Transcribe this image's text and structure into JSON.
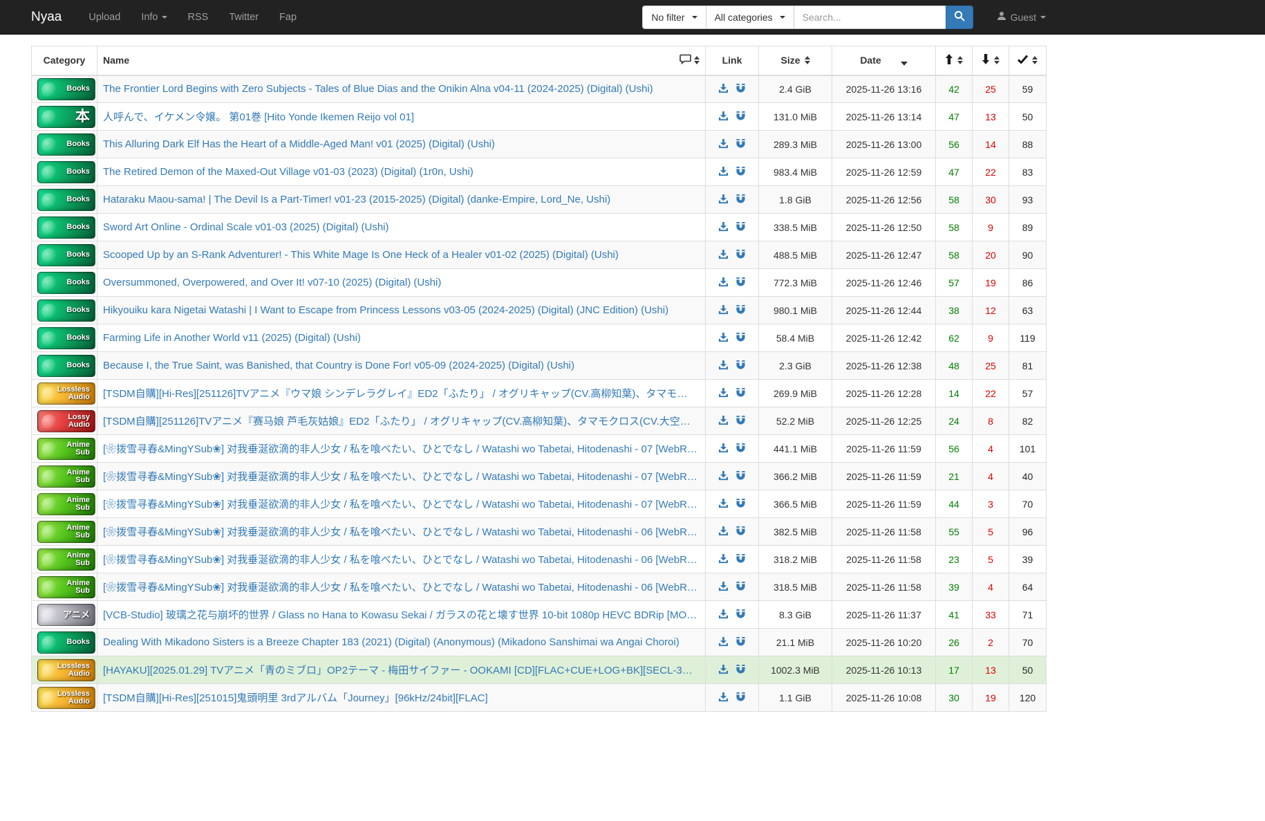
{
  "navbar": {
    "brand": "Nyaa",
    "links": [
      {
        "label": "Upload",
        "caret": false
      },
      {
        "label": "Info",
        "caret": true
      },
      {
        "label": "RSS",
        "caret": false
      },
      {
        "label": "Twitter",
        "caret": false
      },
      {
        "label": "Fap",
        "caret": false
      }
    ],
    "filter_dropdown": "No filter",
    "category_dropdown": "All categories",
    "search_placeholder": "Search...",
    "user_label": "Guest"
  },
  "colors": {
    "navbar_bg": "#222222",
    "accent_blue": "#337ab7",
    "seeders_green": "#008000",
    "leechers_red": "#e00000",
    "success_row_bg": "#dff0d8",
    "striped_row_bg": "#f9f9f9"
  },
  "table": {
    "headers": {
      "category": "Category",
      "name": "Name",
      "link": "Link",
      "size": "Size",
      "date": "Date",
      "seeders_icon": "up-arrow",
      "leechers_icon": "down-arrow",
      "completed_icon": "check"
    }
  },
  "badges": {
    "books-en": {
      "lines": [
        "Books"
      ]
    },
    "books-jp": {
      "lines": [
        "本"
      ]
    },
    "lossless": {
      "lines": [
        "Lossless",
        "Audio"
      ]
    },
    "lossy": {
      "lines": [
        "Lossy",
        "Audio"
      ]
    },
    "anime-sub": {
      "lines": [
        "Anime",
        "Sub"
      ]
    },
    "anime-raw": {
      "lines": [
        "アニメ"
      ]
    }
  },
  "rows": [
    {
      "badge": "books-en",
      "name": "The Frontier Lord Begins with Zero Subjects - Tales of Blue Dias and the Onikin Alna v04-11 (2024-2025) (Digital) (Ushi)",
      "size": "2.4 GiB",
      "date": "2025-11-26 13:16",
      "seeders": "42",
      "leechers": "25",
      "completed": "59",
      "highlight": false
    },
    {
      "badge": "books-jp",
      "name": "人呼んで、イケメン令嬢。 第01巻 [Hito Yonde Ikemen Reijo vol 01]",
      "size": "131.0 MiB",
      "date": "2025-11-26 13:14",
      "seeders": "47",
      "leechers": "13",
      "completed": "50",
      "highlight": false
    },
    {
      "badge": "books-en",
      "name": "This Alluring Dark Elf Has the Heart of a Middle-Aged Man! v01 (2025) (Digital) (Ushi)",
      "size": "289.3 MiB",
      "date": "2025-11-26 13:00",
      "seeders": "56",
      "leechers": "14",
      "completed": "88",
      "highlight": false
    },
    {
      "badge": "books-en",
      "name": "The Retired Demon of the Maxed-Out Village v01-03 (2023) (Digital) (1r0n, Ushi)",
      "size": "983.4 MiB",
      "date": "2025-11-26 12:59",
      "seeders": "47",
      "leechers": "22",
      "completed": "83",
      "highlight": false
    },
    {
      "badge": "books-en",
      "name": "Hataraku Maou-sama! | The Devil Is a Part-Timer! v01-23 (2015-2025) (Digital) (danke-Empire, Lord_Ne, Ushi)",
      "size": "1.8 GiB",
      "date": "2025-11-26 12:56",
      "seeders": "58",
      "leechers": "30",
      "completed": "93",
      "highlight": false
    },
    {
      "badge": "books-en",
      "name": "Sword Art Online - Ordinal Scale v01-03 (2025) (Digital) (Ushi)",
      "size": "338.5 MiB",
      "date": "2025-11-26 12:50",
      "seeders": "58",
      "leechers": "9",
      "completed": "89",
      "highlight": false
    },
    {
      "badge": "books-en",
      "name": "Scooped Up by an S-Rank Adventurer! - This White Mage Is One Heck of a Healer v01-02 (2025) (Digital) (Ushi)",
      "size": "488.5 MiB",
      "date": "2025-11-26 12:47",
      "seeders": "58",
      "leechers": "20",
      "completed": "90",
      "highlight": false
    },
    {
      "badge": "books-en",
      "name": "Oversummoned, Overpowered, and Over It! v07-10 (2025) (Digital) (Ushi)",
      "size": "772.3 MiB",
      "date": "2025-11-26 12:46",
      "seeders": "57",
      "leechers": "19",
      "completed": "86",
      "highlight": false
    },
    {
      "badge": "books-en",
      "name": "Hikyouiku kara Nigetai Watashi | I Want to Escape from Princess Lessons v03-05 (2024-2025) (Digital) (JNC Edition) (Ushi)",
      "size": "980.1 MiB",
      "date": "2025-11-26 12:44",
      "seeders": "38",
      "leechers": "12",
      "completed": "63",
      "highlight": false
    },
    {
      "badge": "books-en",
      "name": "Farming Life in Another World v11 (2025) (Digital) (Ushi)",
      "size": "58.4 MiB",
      "date": "2025-11-26 12:42",
      "seeders": "62",
      "leechers": "9",
      "completed": "119",
      "highlight": false
    },
    {
      "badge": "books-en",
      "name": "Because I, the True Saint, was Banished, that Country is Done For! v05-09 (2024-2025) (Digital) (Ushi)",
      "size": "2.3 GiB",
      "date": "2025-11-26 12:38",
      "seeders": "48",
      "leechers": "25",
      "completed": "81",
      "highlight": false
    },
    {
      "badge": "lossless",
      "name": "[TSDM自購][Hi-Res][251126]TVアニメ『ウマ娘 シンデレラグレイ』ED2「ふたり」 / オグリキャップ(CV.高柳知葉)、タマモ…",
      "size": "269.9 MiB",
      "date": "2025-11-26 12:28",
      "seeders": "14",
      "leechers": "22",
      "completed": "57",
      "highlight": false
    },
    {
      "badge": "lossy",
      "name": "[TSDM自購][251126]TVアニメ『赛马娘 芦毛灰姑娘』ED2「ふたり」 / オグリキャップ(CV.高柳知葉)、タマモクロス(CV.大空…",
      "size": "52.2 MiB",
      "date": "2025-11-26 12:25",
      "seeders": "24",
      "leechers": "8",
      "completed": "82",
      "highlight": false
    },
    {
      "badge": "anime-sub",
      "name": "[❀拨雪寻春&MingYSub❀] 对我垂涎欲滴的非人少女 / 私を喰べたい、ひとでなし / Watashi wo Tabetai, Hitodenashi - 07 [WebR…",
      "size": "441.1 MiB",
      "date": "2025-11-26 11:59",
      "seeders": "56",
      "leechers": "4",
      "completed": "101",
      "highlight": false
    },
    {
      "badge": "anime-sub",
      "name": "[❀拨雪寻春&MingYSub❀] 对我垂涎欲滴的非人少女 / 私を喰べたい、ひとでなし / Watashi wo Tabetai, Hitodenashi - 07 [WebR…",
      "size": "366.2 MiB",
      "date": "2025-11-26 11:59",
      "seeders": "21",
      "leechers": "4",
      "completed": "40",
      "highlight": false
    },
    {
      "badge": "anime-sub",
      "name": "[❀拨雪寻春&MingYSub❀] 对我垂涎欲滴的非人少女 / 私を喰べたい、ひとでなし / Watashi wo Tabetai, Hitodenashi - 07 [WebR…",
      "size": "366.5 MiB",
      "date": "2025-11-26 11:59",
      "seeders": "44",
      "leechers": "3",
      "completed": "70",
      "highlight": false
    },
    {
      "badge": "anime-sub",
      "name": "[❀拨雪寻春&MingYSub❀] 对我垂涎欲滴的非人少女 / 私を喰べたい、ひとでなし / Watashi wo Tabetai, Hitodenashi - 06 [WebR…",
      "size": "382.5 MiB",
      "date": "2025-11-26 11:58",
      "seeders": "55",
      "leechers": "5",
      "completed": "96",
      "highlight": false
    },
    {
      "badge": "anime-sub",
      "name": "[❀拨雪寻春&MingYSub❀] 对我垂涎欲滴的非人少女 / 私を喰べたい、ひとでなし / Watashi wo Tabetai, Hitodenashi - 06 [WebR…",
      "size": "318.2 MiB",
      "date": "2025-11-26 11:58",
      "seeders": "23",
      "leechers": "5",
      "completed": "39",
      "highlight": false
    },
    {
      "badge": "anime-sub",
      "name": "[❀拨雪寻春&MingYSub❀] 对我垂涎欲滴的非人少女 / 私を喰べたい、ひとでなし / Watashi wo Tabetai, Hitodenashi - 06 [WebR…",
      "size": "318.5 MiB",
      "date": "2025-11-26 11:58",
      "seeders": "39",
      "leechers": "4",
      "completed": "64",
      "highlight": false
    },
    {
      "badge": "anime-raw",
      "name": "[VCB-Studio] 玻璃之花与崩坏的世界 / Glass no Hana to Kowasu Sekai / ガラスの花と壊す世界 10-bit 1080p HEVC BDRip [MO…",
      "size": "8.3 GiB",
      "date": "2025-11-26 11:37",
      "seeders": "41",
      "leechers": "33",
      "completed": "71",
      "highlight": false
    },
    {
      "badge": "books-en",
      "name": "Dealing With Mikadono Sisters is a Breeze Chapter 183 (2021) (Digital) (Anonymous) (Mikadono Sanshimai wa Angai Choroi)",
      "size": "21.1 MiB",
      "date": "2025-11-26 10:20",
      "seeders": "26",
      "leechers": "2",
      "completed": "70",
      "highlight": false
    },
    {
      "badge": "lossless",
      "name": "[HAYAKU][2025.01.29] TVアニメ「青のミブロ」OP2テーマ - 梅田サイファー - OOKAMI [CD][FLAC+CUE+LOG+BK][SECL-3…",
      "size": "1002.3 MiB",
      "date": "2025-11-26 10:13",
      "seeders": "17",
      "leechers": "13",
      "completed": "50",
      "highlight": true
    },
    {
      "badge": "lossless",
      "name": "[TSDM自購][Hi-Res][251015]鬼頭明里 3rdアルバム「Journey」[96kHz/24bit][FLAC]",
      "size": "1.1 GiB",
      "date": "2025-11-26 10:08",
      "seeders": "30",
      "leechers": "19",
      "completed": "120",
      "highlight": false
    }
  ]
}
